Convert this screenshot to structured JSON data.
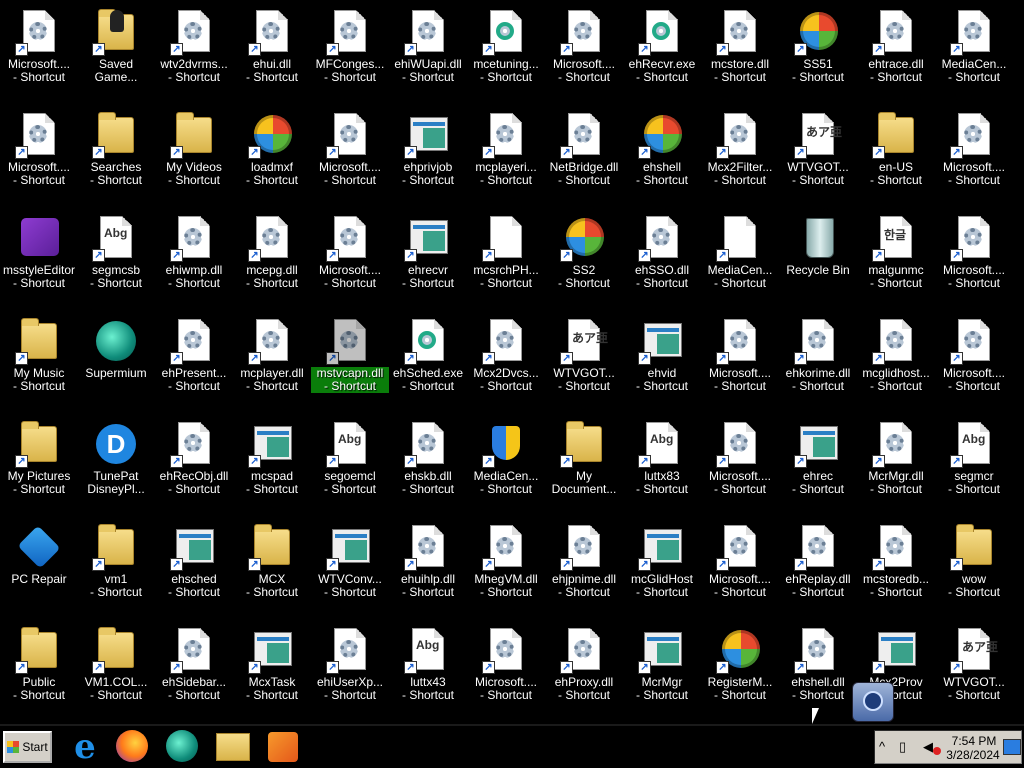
{
  "desktop": {
    "icons": [
      [
        {
          "label": "Microsoft.... - Shortcut",
          "icon": "dll-file-icon"
        },
        {
          "label": "Saved Game...",
          "icon": "saved-games-folder-icon"
        },
        {
          "label": "wtv2dvrms... - Shortcut",
          "icon": "dll-file-icon"
        },
        {
          "label": "ehui.dll - Shortcut",
          "icon": "dll-file-icon"
        },
        {
          "label": "MFConges... - Shortcut",
          "icon": "dll-file-icon"
        },
        {
          "label": "ehiWUapi.dll - Shortcut",
          "icon": "dll-file-icon"
        },
        {
          "label": "mcetuning... - Shortcut",
          "icon": "html-file-icon"
        },
        {
          "label": "Microsoft.... - Shortcut",
          "icon": "dll-file-icon"
        },
        {
          "label": "ehRecvr.exe - Shortcut",
          "icon": "exe-file-icon"
        },
        {
          "label": "mcstore.dll - Shortcut",
          "icon": "dll-file-icon"
        },
        {
          "label": "SS51 - Shortcut",
          "icon": "windows-orb-icon"
        },
        {
          "label": "ehtrace.dll - Shortcut",
          "icon": "dll-file-icon"
        },
        {
          "label": "MediaCen... - Shortcut",
          "icon": "dll-file-icon"
        }
      ],
      [
        {
          "label": "Microsoft.... - Shortcut",
          "icon": "dll-file-icon"
        },
        {
          "label": "Searches - Shortcut",
          "icon": "searches-folder-icon"
        },
        {
          "label": "My Videos - Shortcut",
          "icon": "videos-folder-icon"
        },
        {
          "label": "loadmxf - Shortcut",
          "icon": "windows-orb-icon"
        },
        {
          "label": "Microsoft.... - Shortcut",
          "icon": "dll-file-icon"
        },
        {
          "label": "ehprivjob - Shortcut",
          "icon": "window-app-icon"
        },
        {
          "label": "mcplayeri... - Shortcut",
          "icon": "dll-file-icon"
        },
        {
          "label": "NetBridge.dll - Shortcut",
          "icon": "dll-file-icon"
        },
        {
          "label": "ehshell - Shortcut",
          "icon": "windows-orb-icon"
        },
        {
          "label": "Mcx2Filter... - Shortcut",
          "icon": "dll-file-icon"
        },
        {
          "label": "WTVGOT... - Shortcut",
          "icon": "font-file-icon",
          "fonttxt": "あア亜"
        },
        {
          "label": "en-US - Shortcut",
          "icon": "folder-icon"
        },
        {
          "label": "Microsoft.... - Shortcut",
          "icon": "dll-file-icon"
        }
      ],
      [
        {
          "label": "msstyleEditor - Shortcut",
          "icon": "msstyle-editor-icon"
        },
        {
          "label": "segmcsb - Shortcut",
          "icon": "font-file-icon",
          "fonttxt": "Abg"
        },
        {
          "label": "ehiwmp.dll - Shortcut",
          "icon": "dll-file-icon"
        },
        {
          "label": "mcepg.dll - Shortcut",
          "icon": "dll-file-icon"
        },
        {
          "label": "Microsoft.... - Shortcut",
          "icon": "dll-file-icon"
        },
        {
          "label": "ehrecvr - Shortcut",
          "icon": "window-app-icon"
        },
        {
          "label": "mcsrchPH... - Shortcut",
          "icon": "blank-file-icon"
        },
        {
          "label": "SS2 - Shortcut",
          "icon": "windows-orb-icon"
        },
        {
          "label": "ehSSO.dll - Shortcut",
          "icon": "dll-file-icon"
        },
        {
          "label": "MediaCen... - Shortcut",
          "icon": "blank-file-icon"
        },
        {
          "label": "Recycle Bin",
          "icon": "recycle-bin-icon"
        },
        {
          "label": "malgunmc - Shortcut",
          "icon": "font-file-icon",
          "fonttxt": "한글"
        },
        {
          "label": "Microsoft.... - Shortcut",
          "icon": "dll-file-icon"
        }
      ],
      [
        {
          "label": "My Music - Shortcut",
          "icon": "music-folder-icon"
        },
        {
          "label": "Supermium",
          "icon": "supermium-browser-icon"
        },
        {
          "label": "ehPresent... - Shortcut",
          "icon": "dll-file-icon"
        },
        {
          "label": "mcplayer.dll - Shortcut",
          "icon": "dll-file-icon"
        },
        {
          "label": "mstvcapn.dll - Shortcut",
          "icon": "dll-file-icon",
          "selected": true
        },
        {
          "label": "ehSched.exe - Shortcut",
          "icon": "exe-file-icon"
        },
        {
          "label": "Mcx2Dvcs... - Shortcut",
          "icon": "dll-file-icon"
        },
        {
          "label": "WTVGOT... - Shortcut",
          "icon": "font-file-icon",
          "fonttxt": "あア亜"
        },
        {
          "label": "ehvid - Shortcut",
          "icon": "window-app-icon"
        },
        {
          "label": "Microsoft.... - Shortcut",
          "icon": "dll-file-icon"
        },
        {
          "label": "ehkorime.dll - Shortcut",
          "icon": "dll-file-icon"
        },
        {
          "label": "mcglidhost... - Shortcut",
          "icon": "dll-file-icon"
        },
        {
          "label": "Microsoft.... - Shortcut",
          "icon": "dll-file-icon"
        }
      ],
      [
        {
          "label": "My Pictures - Shortcut",
          "icon": "pictures-folder-icon"
        },
        {
          "label": "TunePat DisneyPl...",
          "icon": "tunepat-disney-icon",
          "glyph": "D"
        },
        {
          "label": "ehRecObj.dll - Shortcut",
          "icon": "dll-file-icon"
        },
        {
          "label": "mcspad - Shortcut",
          "icon": "window-app-icon"
        },
        {
          "label": "segoemcl - Shortcut",
          "icon": "font-file-icon",
          "fonttxt": "Abg"
        },
        {
          "label": "ehskb.dll - Shortcut",
          "icon": "dll-file-icon"
        },
        {
          "label": "MediaCen... - Shortcut",
          "icon": "media-center-shield-icon"
        },
        {
          "label": "My Document...",
          "icon": "documents-folder-icon"
        },
        {
          "label": "luttx83 - Shortcut",
          "icon": "font-file-icon",
          "fonttxt": "Abg"
        },
        {
          "label": "Microsoft.... - Shortcut",
          "icon": "dll-file-icon"
        },
        {
          "label": "ehrec - Shortcut",
          "icon": "window-app-icon"
        },
        {
          "label": "McrMgr.dll - Shortcut",
          "icon": "dll-file-icon"
        },
        {
          "label": "segmcr - Shortcut",
          "icon": "font-file-icon",
          "fonttxt": "Abg"
        }
      ],
      [
        {
          "label": "PC Repair",
          "icon": "pc-repair-icon"
        },
        {
          "label": "vm1 - Shortcut",
          "icon": "folder-icon"
        },
        {
          "label": "ehsched - Shortcut",
          "icon": "window-app-icon"
        },
        {
          "label": "MCX - Shortcut",
          "icon": "folder-icon"
        },
        {
          "label": "WTVConv... - Shortcut",
          "icon": "window-app-icon"
        },
        {
          "label": "ehuihlp.dll - Shortcut",
          "icon": "dll-file-icon"
        },
        {
          "label": "MhegVM.dll - Shortcut",
          "icon": "dll-file-icon"
        },
        {
          "label": "ehjpnime.dll - Shortcut",
          "icon": "dll-file-icon"
        },
        {
          "label": "mcGlidHost - Shortcut",
          "icon": "window-app-icon"
        },
        {
          "label": "Microsoft.... - Shortcut",
          "icon": "dll-file-icon"
        },
        {
          "label": "ehReplay.dll - Shortcut",
          "icon": "dll-file-icon"
        },
        {
          "label": "mcstoredb... - Shortcut",
          "icon": "dll-file-icon"
        },
        {
          "label": "wow - Shortcut",
          "icon": "folder-icon"
        }
      ],
      [
        {
          "label": "Public - Shortcut",
          "icon": "folder-icon"
        },
        {
          "label": "VM1.COL... - Shortcut",
          "icon": "folder-icon"
        },
        {
          "label": "ehSidebar... - Shortcut",
          "icon": "dll-file-icon"
        },
        {
          "label": "McxTask - Shortcut",
          "icon": "window-app-icon"
        },
        {
          "label": "ehiUserXp... - Shortcut",
          "icon": "dll-file-icon"
        },
        {
          "label": "luttx43 - Shortcut",
          "icon": "font-file-icon",
          "fonttxt": "Abg"
        },
        {
          "label": "Microsoft.... - Shortcut",
          "icon": "dll-file-icon"
        },
        {
          "label": "ehProxy.dll - Shortcut",
          "icon": "dll-file-icon"
        },
        {
          "label": "McrMgr - Shortcut",
          "icon": "window-app-icon"
        },
        {
          "label": "RegisterM... - Shortcut",
          "icon": "windows-orb-icon"
        },
        {
          "label": "ehshell.dll - Shortcut",
          "icon": "dll-file-icon"
        },
        {
          "label": "Mcx2Prov - Shortcut",
          "icon": "uac-window-icon"
        },
        {
          "label": "WTVGOT... - Shortcut",
          "icon": "font-file-icon",
          "fonttxt": "あア亜"
        }
      ]
    ]
  },
  "taskbar": {
    "start_label": "Start",
    "apps": [
      "internet-explorer-icon",
      "firefox-icon",
      "supermium-icon",
      "file-explorer-icon",
      "media-player-icon"
    ],
    "ie_glyph": "e",
    "tray": {
      "chevron": "^",
      "time": "7:54 PM",
      "date": "3/28/2024"
    }
  }
}
